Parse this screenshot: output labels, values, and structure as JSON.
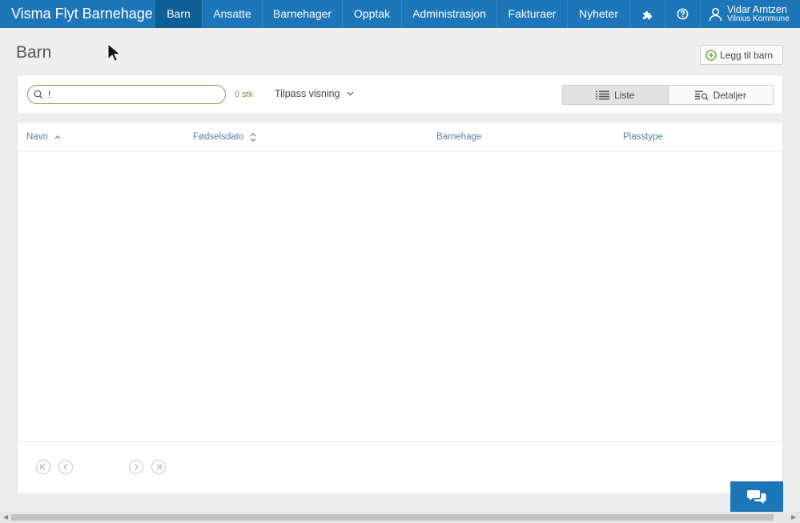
{
  "app": {
    "brand": "Visma Flyt Barnehage"
  },
  "nav": {
    "items": [
      {
        "label": "Barn",
        "active": true
      },
      {
        "label": "Ansatte",
        "active": false
      },
      {
        "label": "Barnehager",
        "active": false
      },
      {
        "label": "Opptak",
        "active": false
      },
      {
        "label": "Administrasjon",
        "active": false
      },
      {
        "label": "Fakturaer",
        "active": false
      },
      {
        "label": "Nyheter",
        "active": false
      }
    ],
    "icons": [
      "puzzle-icon",
      "help-icon"
    ],
    "user": {
      "name": "Vidar Arntzen",
      "org": "Vilnius Kommune"
    }
  },
  "page": {
    "title": "Barn",
    "add_button": "Legg til barn"
  },
  "toolbar": {
    "search_value": "!",
    "count": "0 stk",
    "customize": "Tilpass visning",
    "view_list": "Liste",
    "view_details": "Detaljer",
    "active_view": "Liste"
  },
  "table": {
    "columns": [
      {
        "label": "Navn",
        "sort": "ascending"
      },
      {
        "label": "Fødselsdato",
        "sort": "sortable"
      },
      {
        "label": "Barnehage",
        "sort": "none"
      },
      {
        "label": "Plasstype",
        "sort": "none"
      }
    ],
    "rows": []
  },
  "colors": {
    "nav_bg": "#1d76b8",
    "nav_active": "#0f5f97",
    "accent_green": "#6fab3f",
    "header_text": "#557ea8"
  }
}
